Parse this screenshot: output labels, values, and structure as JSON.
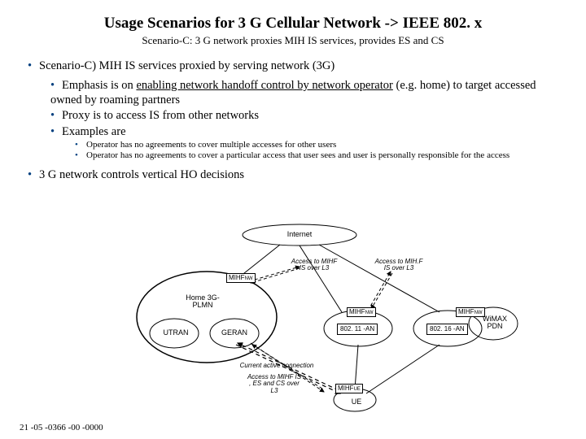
{
  "title": "Usage Scenarios for 3 G Cellular Network -> IEEE 802. x",
  "subtitle": "Scenario-C: 3 G network proxies MIH IS services, provides ES and CS",
  "bullets": {
    "scenario": "Scenario-C) MIH IS services proxied by serving network (3G)",
    "emphasis_pre": "Emphasis is on ",
    "emphasis_u": "enabling network handoff control by network operator",
    "emphasis_post": " (e.g. home) to target accessed owned by roaming partners",
    "proxy": "Proxy is to access IS from other networks",
    "examples": "Examples are",
    "ex1": "Operator has no agreements to cover multiple accesses for other users",
    "ex2": "Operator has no agreements to cover a particular access that user sees and user is personally responsible for the access",
    "controls": "3 G network controls vertical HO decisions"
  },
  "diagram": {
    "internet": "Internet",
    "mih_nw": "MIHF",
    "mih_nw_sub": "NW",
    "mih_ue": "MIHF",
    "mih_ue_sub": "UE",
    "home_plmn": "Home 3G-PLMN",
    "utran": "UTRAN",
    "geran": "GERAN",
    "an_80211": "802. 11 -AN",
    "an_80216": "802. 16 -AN",
    "wimax_pdn": "WiMAX PDN",
    "ue": "UE",
    "access_l3_a": "Access to MIHF IS over L3",
    "access_l3_b": "Access to MIH.F IS over L3",
    "conn_note": "Current active connection",
    "access_es_cs": "Access to MIHF IS , ES and CS over L3"
  },
  "footer": "21 -05 -0366 -00 -0000"
}
